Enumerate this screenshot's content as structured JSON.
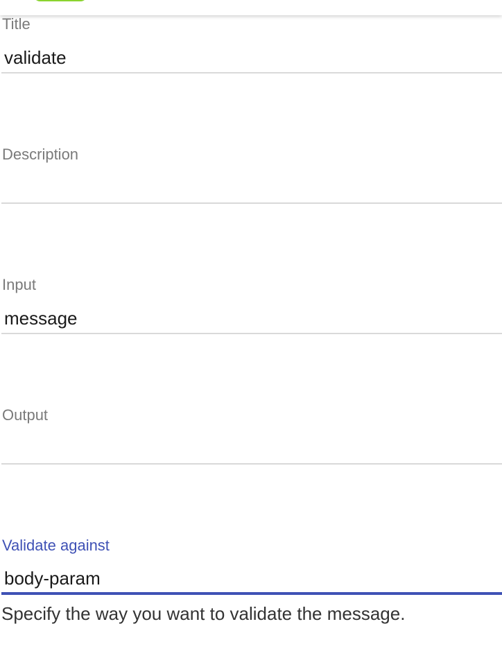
{
  "form": {
    "title": {
      "label": "Title",
      "value": "validate"
    },
    "description": {
      "label": "Description",
      "value": ""
    },
    "input": {
      "label": "Input",
      "value": "message"
    },
    "output": {
      "label": "Output",
      "value": ""
    },
    "validate_against": {
      "label": "Validate against",
      "value": "body-param",
      "hint": "Specify the way you want to validate the message."
    }
  },
  "colors": {
    "accent": "#3f51b5",
    "label": "#7a7a7a",
    "divider": "#d9d9d9",
    "top_pill": "#8ad32f"
  }
}
